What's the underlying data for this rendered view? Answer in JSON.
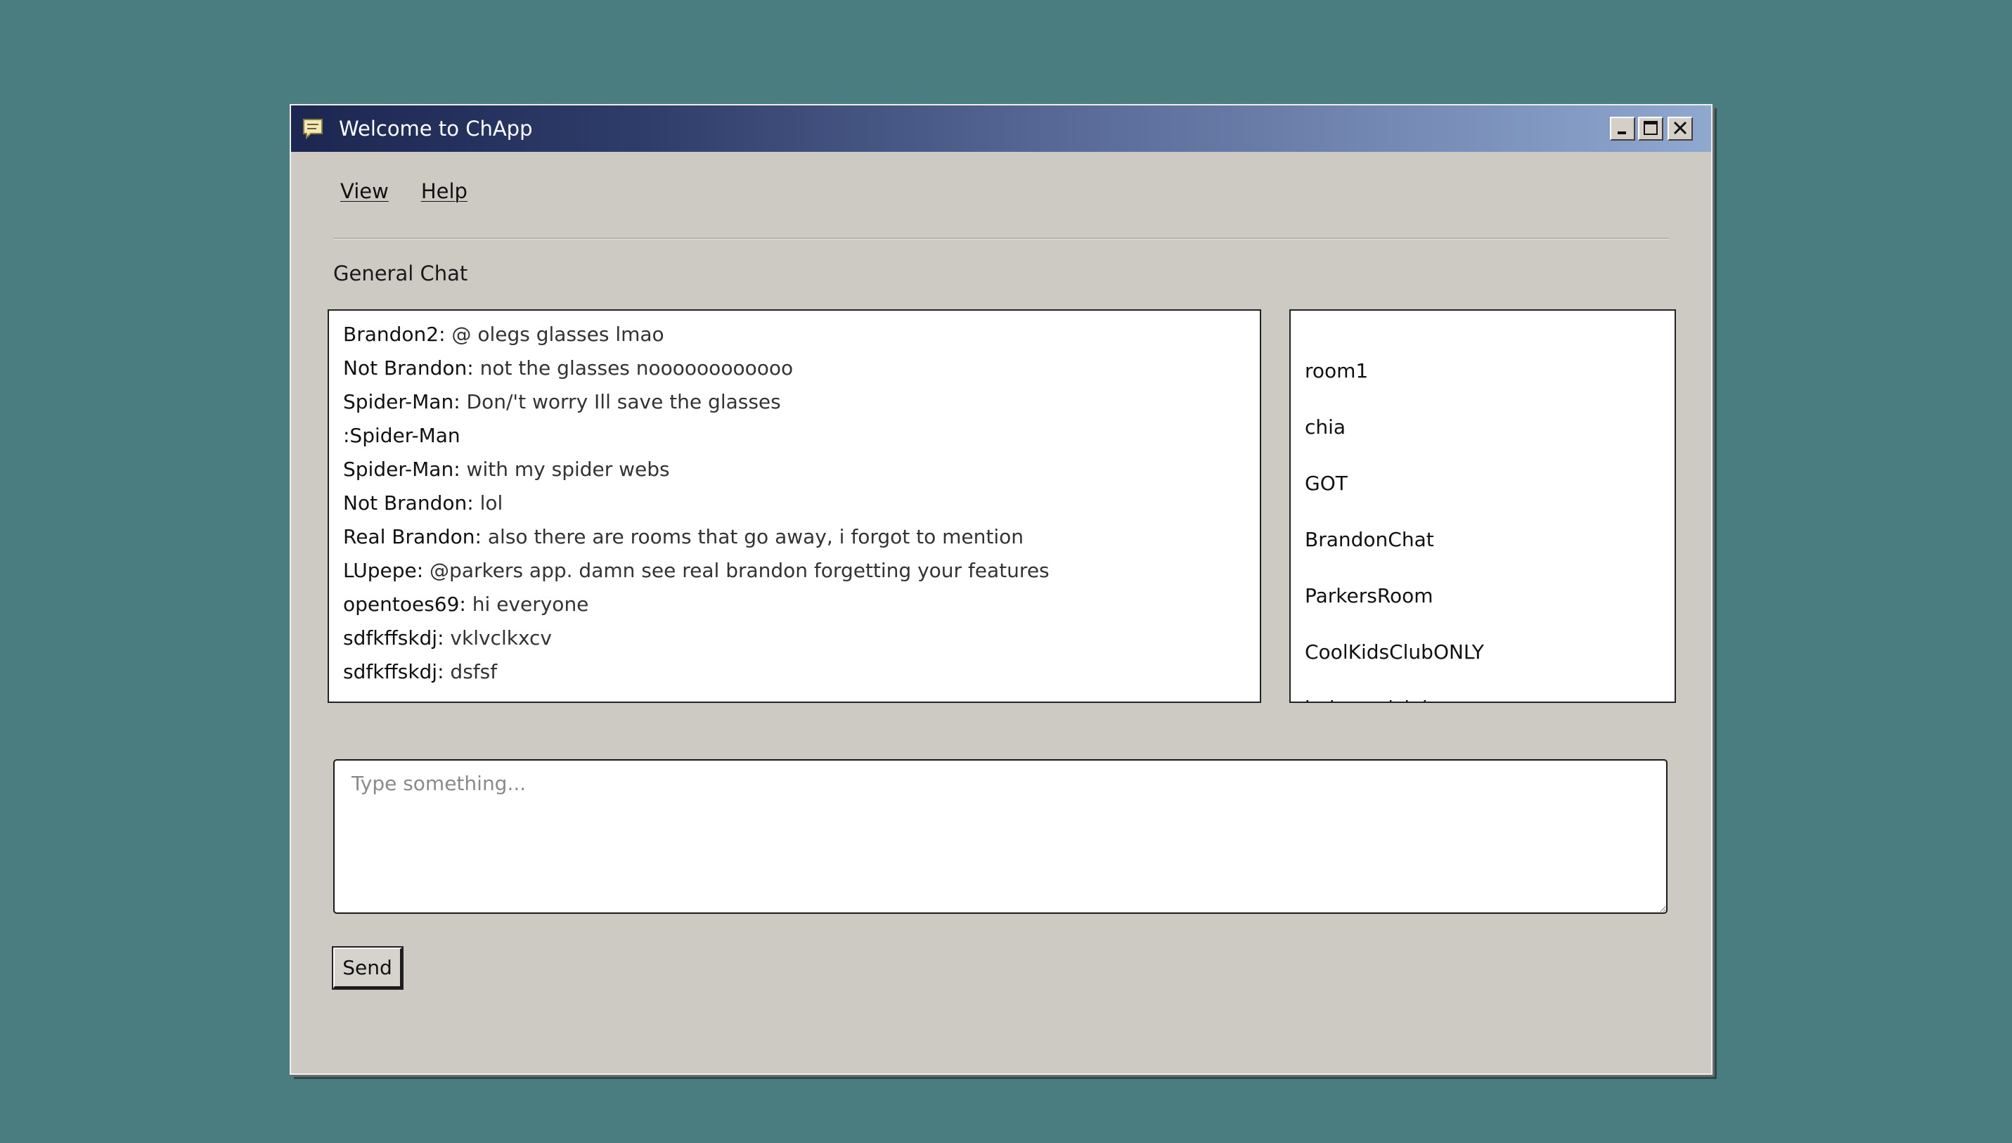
{
  "window": {
    "title": "Welcome to ChApp"
  },
  "menu": {
    "items": [
      {
        "label": "View"
      },
      {
        "label": "Help"
      }
    ]
  },
  "room": {
    "title": "General Chat"
  },
  "messages": [
    {
      "user": "Brandon2:",
      "text": " @ olegs glasses lmao"
    },
    {
      "user": "Not Brandon:",
      "text": " not the glasses noooooooooooo"
    },
    {
      "user": "Spider-Man:",
      "text": " Don/'t worry Ill save the glasses"
    },
    {
      "user": ":Spider-Man",
      "text": ""
    },
    {
      "user": "Spider-Man:",
      "text": " with my spider webs"
    },
    {
      "user": "Not Brandon:",
      "text": " lol"
    },
    {
      "user": "Real Brandon:",
      "text": " also there are rooms that go away, i forgot to mention"
    },
    {
      "user": "LUpepe:",
      "text": " @parkers app. damn see real brandon forgetting your features"
    },
    {
      "user": "opentoes69:",
      "text": " hi everyone"
    },
    {
      "user": "sdfkffskdj:",
      "text": " vklvclkxcv"
    },
    {
      "user": "sdfkffskdj:",
      "text": " dsfsf"
    }
  ],
  "rooms": [
    {
      "name": "room1"
    },
    {
      "name": "chia"
    },
    {
      "name": "GOT"
    },
    {
      "name": "BrandonChat"
    },
    {
      "name": "ParkersRoom"
    },
    {
      "name": "CoolKidsClubONLY"
    },
    {
      "name": "babysealclub"
    }
  ],
  "compose": {
    "placeholder": "Type something...",
    "value": "",
    "send_label": "Send"
  },
  "colors": {
    "desktop": "#4a7d7f",
    "window_bg": "#cdc9c3",
    "titlebar_start": "#1c2651",
    "titlebar_end": "#8fa8cf"
  },
  "icons": {
    "app": "chat-bubble-icon",
    "minimize": "minimize-icon",
    "maximize": "maximize-icon",
    "close": "close-icon"
  }
}
